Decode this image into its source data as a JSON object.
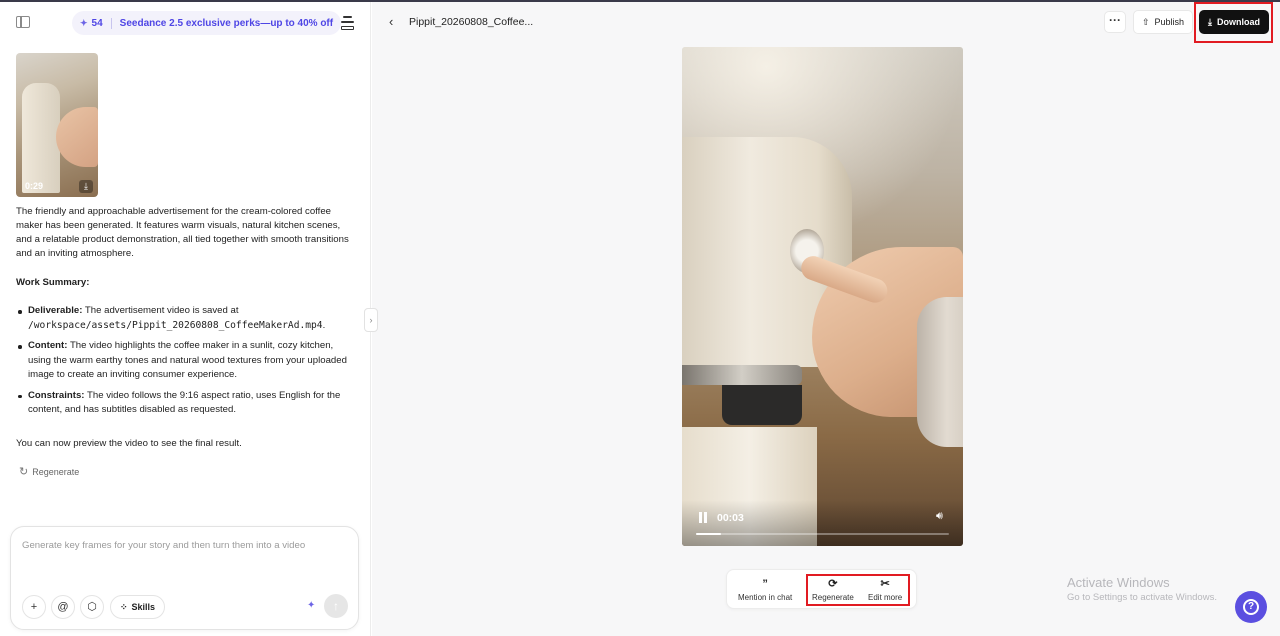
{
  "promo": {
    "count": "54",
    "text": "Seedance 2.5 exclusive perks—up to 40% off"
  },
  "thumbnail": {
    "duration": "0:29"
  },
  "message": {
    "intro": "The friendly and approachable advertisement for the cream-colored coffee maker has been generated. It features warm visuals, natural kitchen scenes, and a relatable product demonstration, all tied together with smooth transitions and an inviting atmosphere.",
    "summary_heading": "Work Summary:",
    "bullets": [
      {
        "label": "Deliverable:",
        "text_pre": "The advertisement video is saved at",
        "code": "/workspace/assets/Pippit_20260808_CoffeeMakerAd.mp4",
        "text_post": "."
      },
      {
        "label": "Content:",
        "text": "The video highlights the coffee maker in a sunlit, cozy kitchen, using the warm earthy tones and natural wood textures from your uploaded image to create an inviting consumer experience."
      },
      {
        "label": "Constraints:",
        "text": "The video follows the 9:16 aspect ratio, uses English for the content, and has subtitles disabled as requested."
      }
    ],
    "closing": "You can now preview the video to see the final result.",
    "regenerate_label": "Regenerate"
  },
  "composer": {
    "placeholder": "Generate key frames for your story and then turn them into a video",
    "skills_label": "Skills"
  },
  "header": {
    "title": "Pippit_20260808_Coffee...",
    "more_label": "···",
    "publish_label": "Publish",
    "download_label": "Download"
  },
  "player": {
    "time": "00:03",
    "progress": 0.1
  },
  "actions": {
    "mention_label": "Mention in chat",
    "regenerate_label": "Regenerate",
    "edit_label": "Edit more"
  },
  "watermark": {
    "line1": "Activate Windows",
    "line2": "Go to Settings to activate Windows."
  },
  "colors": {
    "accent": "#4f46e5",
    "highlight_box": "#e11b22",
    "download_bg": "#111111",
    "help_bg": "#5b4fe0"
  }
}
